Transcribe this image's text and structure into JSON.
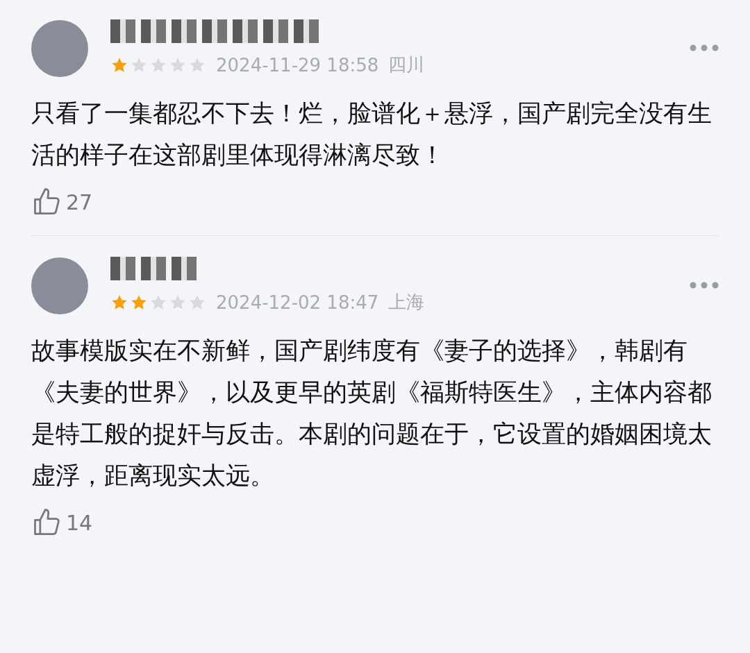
{
  "reviews": [
    {
      "stars": 1,
      "date": "2024-11-29 18:58",
      "location": "四川",
      "text": "只看了一集都忍不下去！烂，脸谱化＋悬浮，国产剧完全没有生活的样子在这部剧里体现得淋漓尽致！",
      "likes": "27"
    },
    {
      "stars": 2,
      "date": "2024-12-02 18:47",
      "location": "上海",
      "text": "故事模版实在不新鲜，国产剧纬度有《妻子的选择》，韩剧有《夫妻的世界》，以及更早的英剧《福斯特医生》，主体内容都是特工般的捉奸与反击。本剧的问题在于，它设置的婚姻困境太虚浮，距离现实太远。",
      "likes": "14"
    }
  ]
}
